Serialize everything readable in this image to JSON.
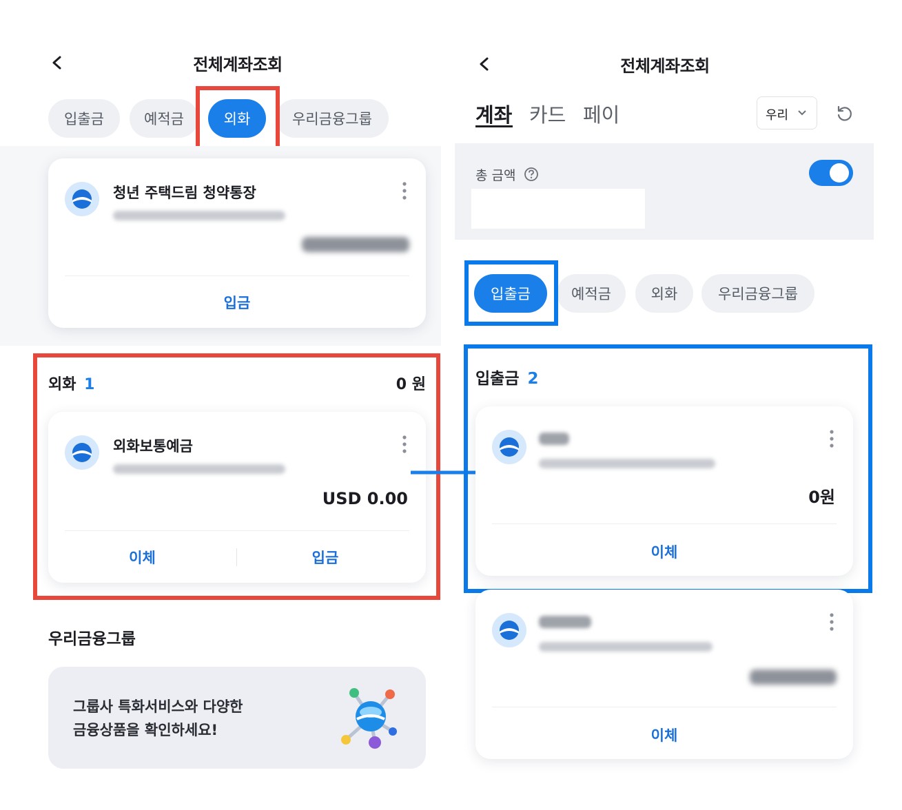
{
  "left": {
    "header": {
      "title": "전체계좌조회"
    },
    "chips": [
      "입출금",
      "예적금",
      "외화",
      "우리금융그룹"
    ],
    "savings_card": {
      "name": "청년 주택드림 청약통장",
      "action": "입금"
    },
    "section": {
      "title": "외화",
      "count": "1",
      "total": "0 원"
    },
    "fx_card": {
      "name": "외화보통예금",
      "balance": "USD 0.00",
      "action_transfer": "이체",
      "action_deposit": "입금"
    },
    "group": {
      "title": "우리금융그룹",
      "banner_line1": "그룹사 특화서비스와 다양한",
      "banner_line2": "금융상품을 확인하세요!"
    }
  },
  "right": {
    "header": {
      "title": "전체계좌조회"
    },
    "tabs": [
      "계좌",
      "카드",
      "페이"
    ],
    "bank_select": "우리",
    "total_label": "총 금액",
    "chips": [
      "입출금",
      "예적금",
      "외화",
      "우리금융그룹"
    ],
    "section": {
      "title": "입출금",
      "count": "2"
    },
    "card1": {
      "balance": "0원",
      "action": "이체"
    },
    "card2": {
      "action": "이체"
    }
  },
  "colors": {
    "accent": "#1a7fe8",
    "highlight_red": "#e8473b",
    "highlight_blue": "#0a7aeb"
  }
}
